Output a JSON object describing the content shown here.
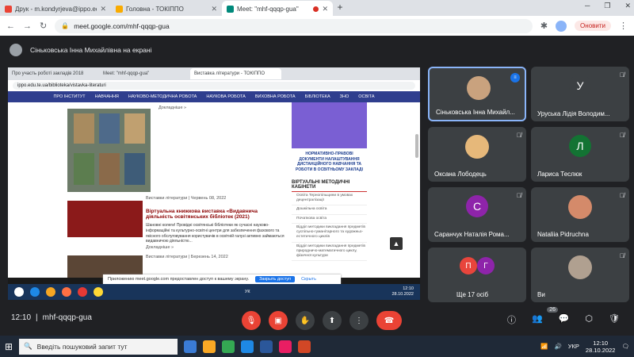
{
  "browser": {
    "tabs": [
      {
        "label": "Друк - m.kondyrjeva@ippo.edu",
        "fav": "#ea4335",
        "active": false
      },
      {
        "label": "Головна - ТОКІППО",
        "fav": "#f9ab00",
        "active": false
      },
      {
        "label": "Meet: \"mhf-qqqp-gua\"",
        "fav": "#00897b",
        "active": true
      }
    ],
    "url": "meet.google.com/mhf-qqqp-gua",
    "update_label": "Оновити",
    "new_tab_symbol": "+",
    "close_symbol": "✕"
  },
  "meet": {
    "presenter_text": "Сіньковська Інна Михайлівна на екрані",
    "meeting_code": "mhf-qqqp-gua",
    "time": "12:10",
    "participants_badge": "26"
  },
  "shared": {
    "tabs": [
      "Про участь роботі закладів 2018",
      "Meet: \"mhf-qqqp-gua\"",
      "Виставка літератури - ТОКІППО"
    ],
    "url": "ippo.edu.te.ua/biblioteka/vistavka-literaturi",
    "nav": [
      "ПРО ІНСТИТУТ",
      "НАВЧАННЯ",
      "НАУКОВО-МЕТОДИЧНА РОБОТА",
      "НАУКОВА РОБОТА",
      "ВИХОВНА РОБОТА",
      "БІБЛІОТЕКА",
      "ЗНО",
      "ОСВІТА"
    ],
    "more_link": "Докладніше »",
    "article_meta": "Виставки літератури  |  Червень 08, 2022",
    "article_title": "Віртуальна книжкова виставка «Видавнича діяльність освітянських бібліотек (2021)",
    "article_text": "Шановні колеги! Провідні освітянські бібліотеки як сучасні науково-інформаційні та культурно-освітні центри для забезпечення фахового та якісного обслуговування користувачів в освітній галузі активно займаються видавничою діяльністю...",
    "article_meta2": "Виставки літератури  |  Березень 14, 2022",
    "promo_text": "НОРМАТИВНО-ПРАВОВІ ДОКУМЕНТИ НАЛАШТУВАННЯ ДИСТАНЦІЙНОГО НАВЧАННЯ ТА РОБОТИ В ОСВІТНЬОМУ ЗАКЛАДІ",
    "sidebar_head": "ВІРТУАЛЬНІ МЕТОДИЧНІ КАБІНЕТИ",
    "sidebar_items": [
      "Освіта Тернопільщини в умовах децентралізації",
      "Дошкільна освіта",
      "Початкова освіта",
      "Відділ методики викладання предметів суспільно-гуманітарного та художньо-естетичного циклів",
      "Відділ методики викладання предметів природничо-математичного циклу, фізичної культури"
    ],
    "share_text": "Приложению meet.google.com предоставлен доступ к вашему экрану.",
    "share_stop": "Закрыть доступ",
    "share_hide": "Скрыть",
    "task_time": "12:10",
    "task_date": "28.10.2022",
    "task_lang": "УК"
  },
  "participants": [
    {
      "name": "Сіньковська Інна Михайл...",
      "type": "photo",
      "color": "#c9a27e",
      "speaking": true
    },
    {
      "name": "Уруська Лідія Володим...",
      "type": "letter",
      "letter": "У",
      "color": "#3c4043"
    },
    {
      "name": "Оксана Лободець",
      "type": "photo",
      "color": "#e6b87a"
    },
    {
      "name": "Лариса Теслюк",
      "type": "letter",
      "letter": "Л",
      "color": "#137333"
    },
    {
      "name": "Саранчук Наталія Рома...",
      "type": "letter",
      "letter": "С",
      "color": "#8e24aa"
    },
    {
      "name": "Nataliia Pidruchna",
      "type": "photo",
      "color": "#d48a6a"
    },
    {
      "name": "Ще 17 осіб",
      "type": "group",
      "letters": [
        "П",
        "Г"
      ],
      "colors": [
        "#e8453c",
        "#8e24aa"
      ]
    },
    {
      "name": "Ви",
      "type": "photo",
      "color": "#b0a090"
    }
  ],
  "taskbar": {
    "search_placeholder": "Введіть пошуковий запит тут",
    "time": "12:10",
    "date": "28.10.2022",
    "lang": "УКР"
  }
}
